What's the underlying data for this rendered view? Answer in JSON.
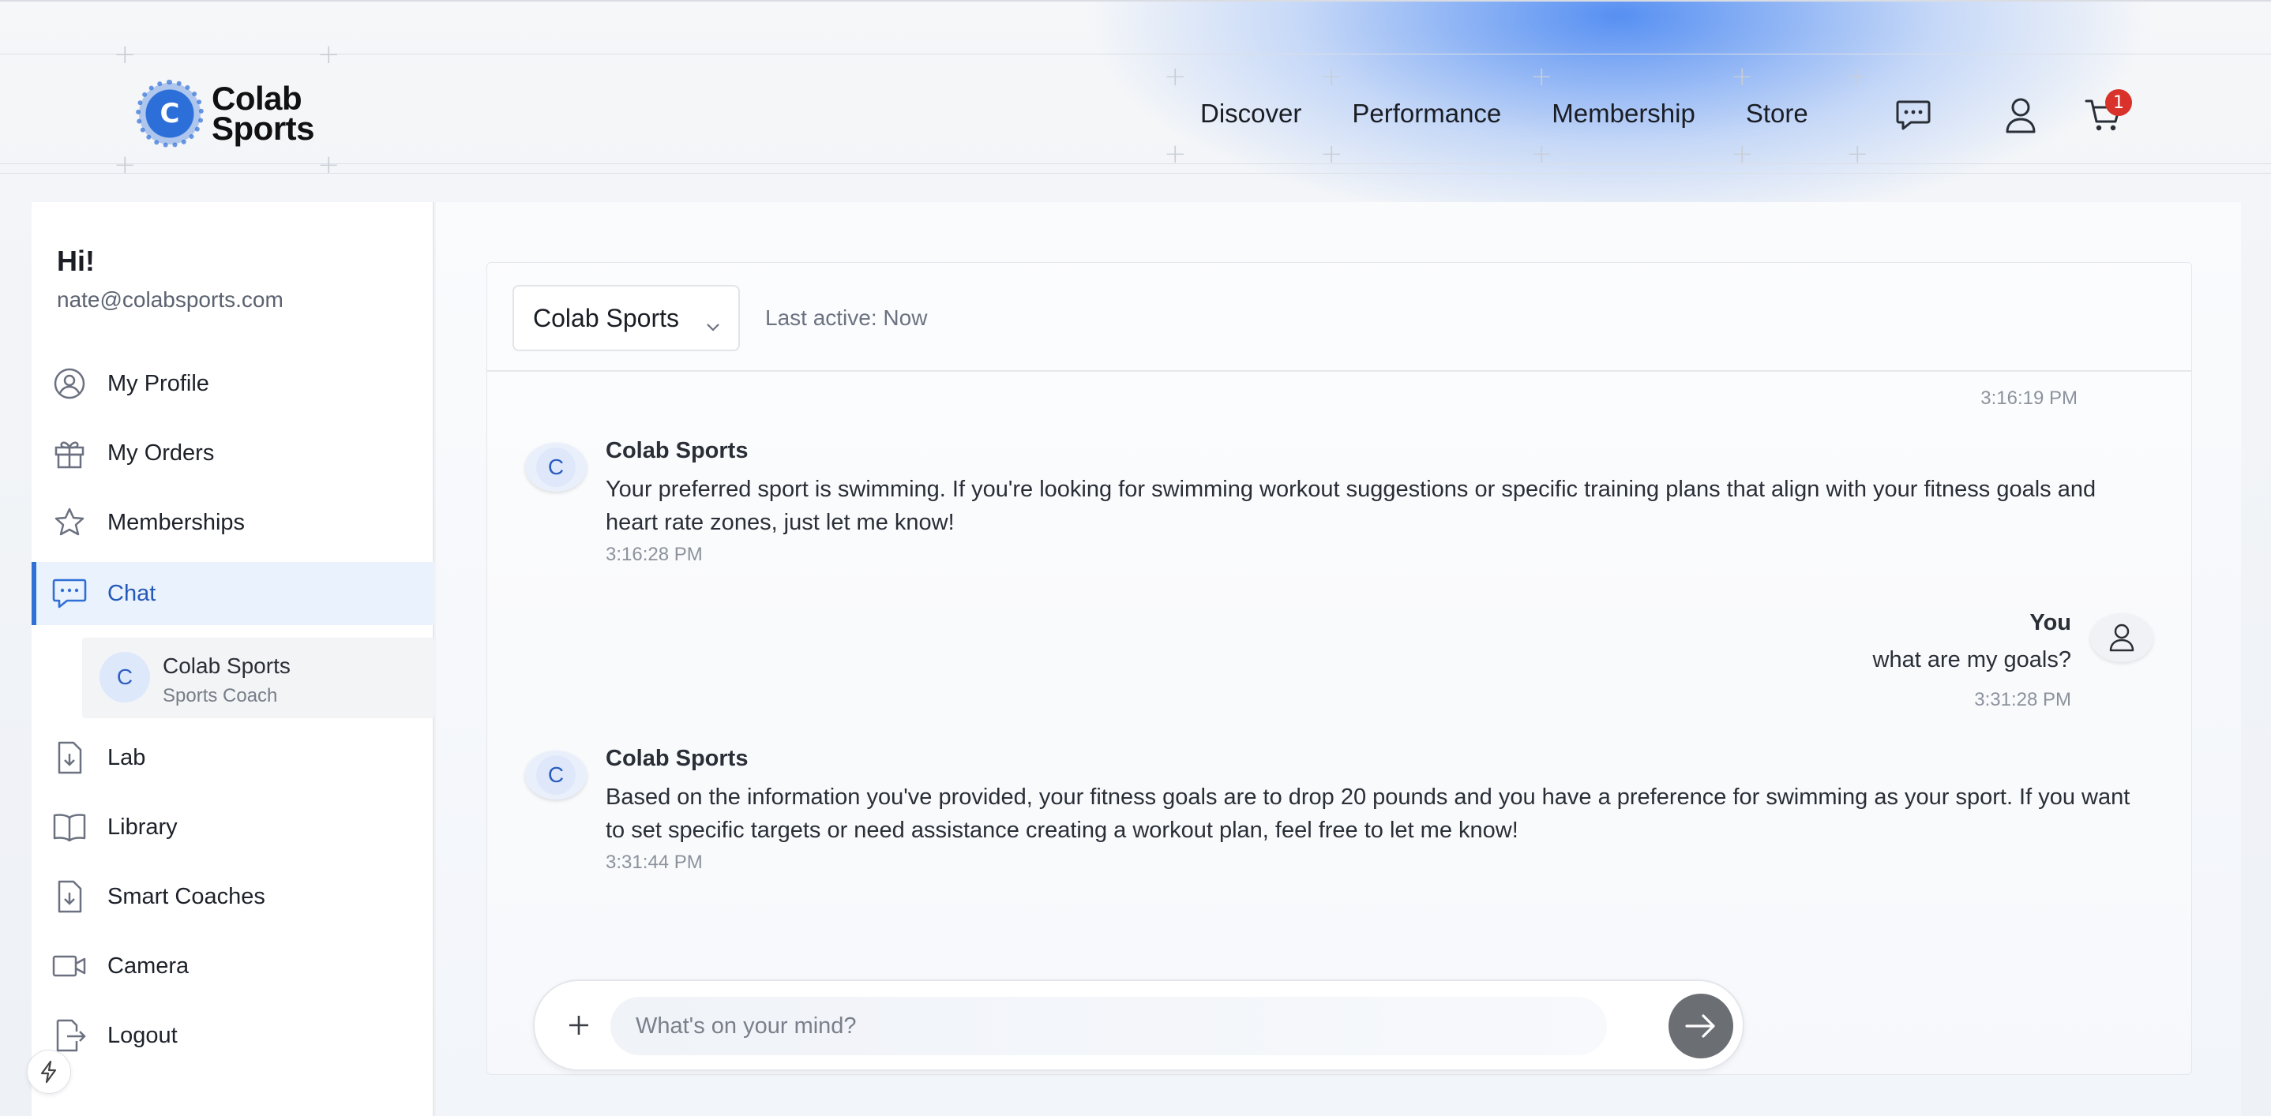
{
  "brand": {
    "name_line1": "Colab",
    "name_line2": "Sports",
    "logo_letter": "C"
  },
  "nav": {
    "items": [
      "Discover",
      "Performance",
      "Membership",
      "Store"
    ],
    "cart_count": "1"
  },
  "sidebar": {
    "greeting": "Hi!",
    "email": "nate@colabsports.com",
    "items": [
      {
        "label": "My Profile",
        "icon": "user-circle-icon"
      },
      {
        "label": "My Orders",
        "icon": "gift-icon"
      },
      {
        "label": "Memberships",
        "icon": "star-icon"
      },
      {
        "label": "Chat",
        "icon": "chat-icon"
      },
      {
        "label": "Lab",
        "icon": "file-download-icon"
      },
      {
        "label": "Library",
        "icon": "book-icon"
      },
      {
        "label": "Smart Coaches",
        "icon": "file-download-icon"
      },
      {
        "label": "Camera",
        "icon": "video-camera-icon"
      },
      {
        "label": "Logout",
        "icon": "logout-icon"
      }
    ],
    "active_item": "Chat",
    "chat_sub": {
      "avatar_letter": "C",
      "name": "Colab Sports",
      "role": "Sports Coach"
    }
  },
  "chat": {
    "selected_coach": "Colab Sports",
    "last_active": "Last active: Now",
    "prev_timestamp": "3:16:19 PM",
    "messages": [
      {
        "from": "Colab Sports",
        "avatar_letter": "C",
        "text": "Your preferred sport is swimming. If you're looking for swimming workout suggestions or specific training plans that align with your fitness goals and heart rate zones, just let me know!",
        "time": "3:16:28 PM"
      },
      {
        "from": "You",
        "text": "what are my goals?",
        "time": "3:31:28 PM"
      },
      {
        "from": "Colab Sports",
        "avatar_letter": "C",
        "text": "Based on the information you've provided, your fitness goals are to drop 20 pounds and you have a preference for swimming as your sport. If you want to set specific targets or need assistance creating a workout plan, feel free to let me know!",
        "time": "3:31:44 PM"
      }
    ],
    "composer": {
      "placeholder": "What's on your mind?",
      "value": ""
    }
  },
  "colors": {
    "accent": "#2f6fd6",
    "badge": "#d8322a",
    "send_button": "#6b6e73",
    "active_bg": "#eaf2fd"
  }
}
